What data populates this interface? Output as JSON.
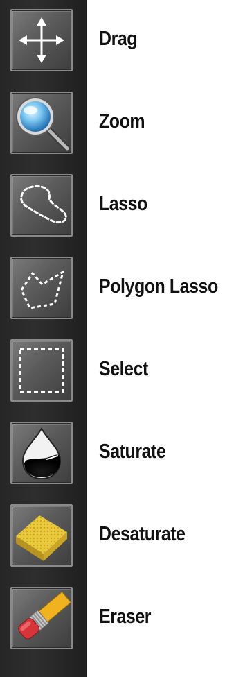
{
  "tools": [
    {
      "label": "Drag",
      "icon": "move-arrows-icon"
    },
    {
      "label": "Zoom",
      "icon": "magnifier-icon"
    },
    {
      "label": "Lasso",
      "icon": "lasso-icon"
    },
    {
      "label": "Polygon Lasso",
      "icon": "polygon-lasso-icon"
    },
    {
      "label": "Select",
      "icon": "select-rectangle-icon"
    },
    {
      "label": "Saturate",
      "icon": "drop-icon"
    },
    {
      "label": "Desaturate",
      "icon": "sponge-icon"
    },
    {
      "label": "Eraser",
      "icon": "eraser-icon"
    }
  ],
  "colors": {
    "toolbar_bg": "#262626",
    "button_bg": "#5a5a5a",
    "label_text": "#111111"
  }
}
